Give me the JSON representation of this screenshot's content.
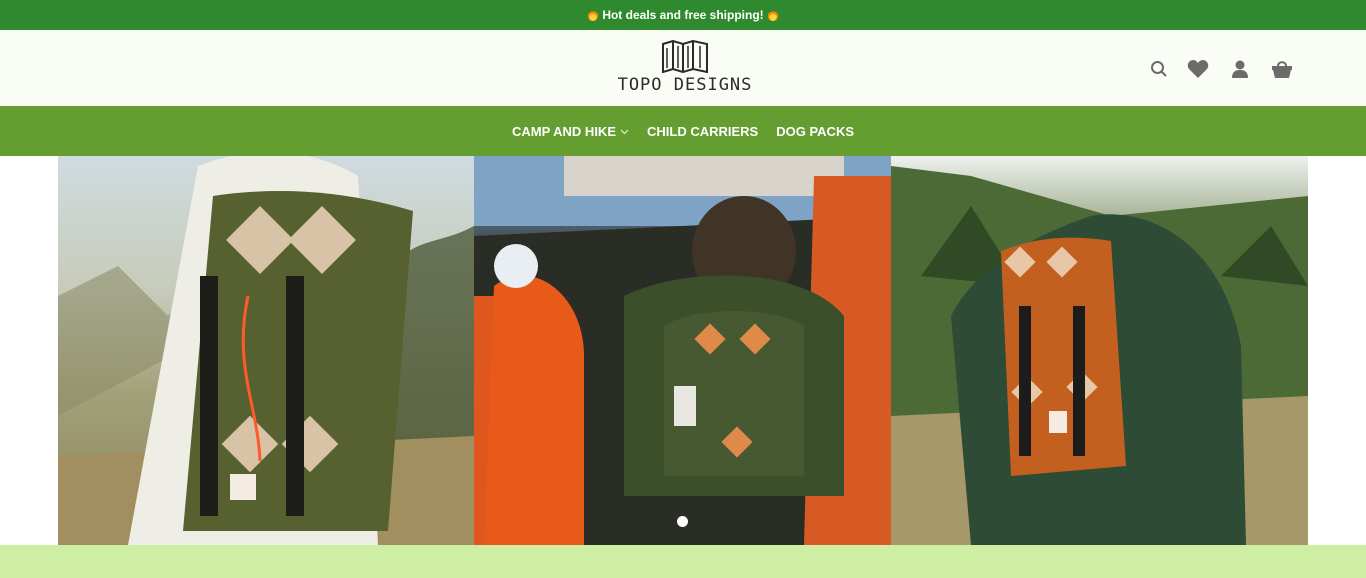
{
  "announcement": {
    "text": "Hot deals and free shipping!"
  },
  "brand": {
    "name": "TOPO DESIGNS"
  },
  "header": {
    "icons": [
      "search-icon",
      "heart-icon",
      "user-icon",
      "cart-icon"
    ]
  },
  "nav": {
    "items": [
      {
        "label": "CAMP AND HIKE",
        "has_dropdown": true
      },
      {
        "label": "CHILD CARRIERS",
        "has_dropdown": false
      },
      {
        "label": "DOG PACKS",
        "has_dropdown": false
      }
    ]
  },
  "hero": {
    "slides_count": 1,
    "active_slide": 1
  },
  "colors": {
    "announcement_bg": "#2f8a2f",
    "nav_bg": "#649d30",
    "header_bg": "#fafdf5",
    "footer_band": "#cdeea3"
  }
}
